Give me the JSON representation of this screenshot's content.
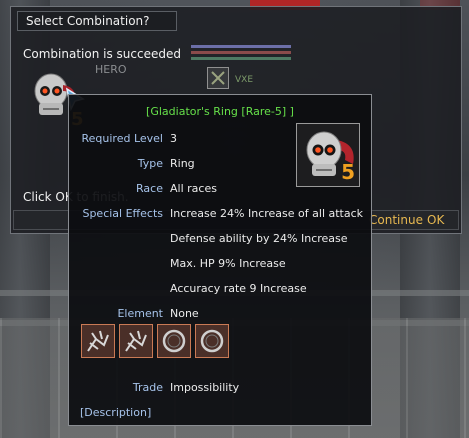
{
  "dialog": {
    "title": "Select Combination?",
    "status": "Combination is succeeded",
    "hero_label": "HERO",
    "slot_label": "VXE",
    "finish_text": "Click OK to finish.",
    "buttons": {
      "continue": "Continue",
      "ok": "OK"
    },
    "item_level_badge": "5"
  },
  "tooltip": {
    "title": "[Gladiator's Ring [Rare-5] ]",
    "rows": [
      {
        "label": "Required Level",
        "value": "3"
      },
      {
        "label": "Type",
        "value": "Ring"
      },
      {
        "label": "Race",
        "value": "All races"
      },
      {
        "label": "Special Effects",
        "value": "Increase 24% Increase of all attack"
      }
    ],
    "effects_more": [
      "Defense ability by 24% Increase",
      "Max. HP 9% Increase",
      "Accuracy rate 9 Increase"
    ],
    "element": {
      "label": "Element",
      "value": "None"
    },
    "element_slots": [
      "engraved-rune-icon",
      "engraved-rune-icon",
      "empty-ring-slot-icon",
      "empty-ring-slot-icon"
    ],
    "trade": {
      "label": "Trade",
      "value": "Impossibility"
    },
    "description_link": "[Description]",
    "icon_badge": "5"
  },
  "colors": {
    "title_green": "#66e04a",
    "label_blue": "#a6c3ea",
    "button_gold": "#e7b850",
    "badge_orange": "#f0a020"
  }
}
